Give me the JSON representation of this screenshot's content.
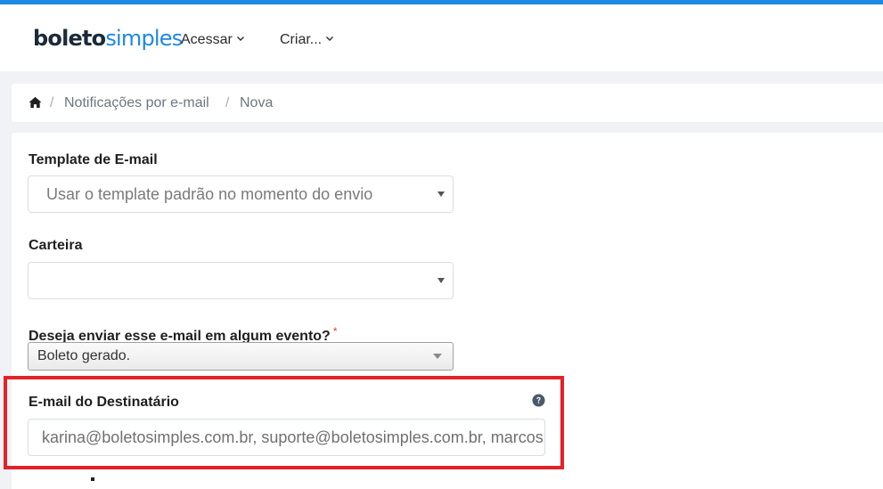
{
  "header": {
    "logo_part1": "boleto",
    "logo_part2": "simples",
    "nav": [
      {
        "label": "Acessar"
      },
      {
        "label": "Criar..."
      }
    ]
  },
  "breadcrumb": {
    "separator": "/",
    "items": [
      "Notificações por e-mail",
      "Nova"
    ]
  },
  "form": {
    "template": {
      "label": "Template de E-mail",
      "value": "Usar o template padrão no momento do envio"
    },
    "carteira": {
      "label": "Carteira",
      "value": ""
    },
    "evento": {
      "label": "Deseja enviar esse e-mail em algum evento?",
      "required_mark": "*",
      "value": "Boleto gerado."
    },
    "destinatario": {
      "label": "E-mail do Destinatário",
      "value": "karina@boletosimples.com.br, suporte@boletosimples.com.br, marcos@boletosimples.com.br"
    }
  },
  "colors": {
    "brand_blue": "#1e88e5",
    "brand_dark": "#1b2a3a",
    "highlight_red": "#e32228",
    "required_red": "#e53935",
    "help_icon": "#4a5a6a"
  },
  "icons": {
    "home": "home-icon",
    "nav_chevron": "chevron-down-icon",
    "select_caret": "caret-down-icon",
    "help": "question-circle-icon"
  }
}
